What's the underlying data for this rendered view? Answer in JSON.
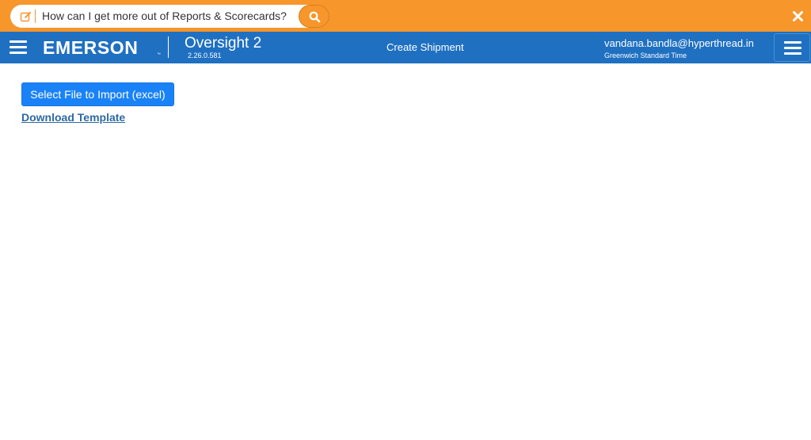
{
  "help_bar": {
    "prompt": "How can I get more out of Reports & Scorecards?",
    "edit_icon": "edit-icon",
    "search_icon": "search-icon",
    "close_icon": "close-icon"
  },
  "header": {
    "brand": "EMERSON",
    "brand_tm": "™",
    "app_name": "Oversight 2",
    "version": "2.26.0.581",
    "page_title": "Create Shipment",
    "user_email": "vandana.bandla@hyperthread.in",
    "timezone": "Greenwich Standard Time",
    "left_menu_icon": "hamburger-icon",
    "right_menu_icon": "hamburger-icon"
  },
  "main": {
    "import_button": "Select File to Import (excel)",
    "download_link": "Download Template"
  },
  "colors": {
    "help_bar": "#f7962b",
    "header": "#1f70c1",
    "primary_button": "#1a82f7",
    "link": "#2d6aa3"
  }
}
